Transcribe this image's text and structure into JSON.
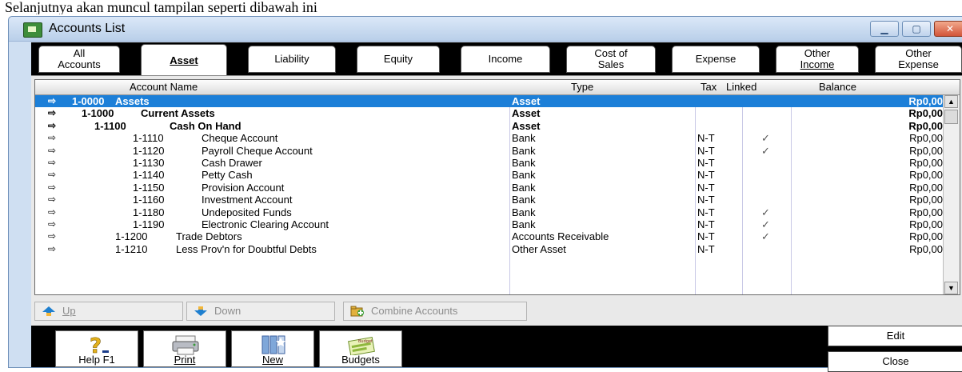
{
  "doc_text": "Selanjutnya akan muncul tampilan seperti dibawah ini",
  "window": {
    "title": "Accounts List"
  },
  "title_buttons": {
    "min": "▁",
    "max": "▢",
    "close": "✕"
  },
  "tabs": [
    {
      "line1": "All",
      "line2": "Accounts"
    },
    {
      "line1": "Asset",
      "line2": ""
    },
    {
      "line1": "Liability",
      "line2": ""
    },
    {
      "line1": "Equity",
      "line2": ""
    },
    {
      "line1": "Income",
      "line2": ""
    },
    {
      "line1": "Cost of",
      "line2": "Sales"
    },
    {
      "line1": "Expense",
      "line2": ""
    },
    {
      "line1": "Other",
      "line2": "Income"
    },
    {
      "line1": "Other",
      "line2": "Expense"
    }
  ],
  "columns": {
    "name": "Account Name",
    "type": "Type",
    "tax": "Tax",
    "linked": "Linked",
    "balance": "Balance"
  },
  "rows": [
    {
      "number": "1-0000",
      "name": "Assets",
      "type": "Asset",
      "tax": "",
      "linked": "",
      "balance": "Rp0,00"
    },
    {
      "number": "1-1000",
      "name": "Current Assets",
      "type": "Asset",
      "tax": "",
      "linked": "",
      "balance": "Rp0,00"
    },
    {
      "number": "1-1100",
      "name": "Cash On Hand",
      "type": "Asset",
      "tax": "",
      "linked": "",
      "balance": "Rp0,00"
    },
    {
      "number": "1-1110",
      "name": "Cheque Account",
      "type": "Bank",
      "tax": "N-T",
      "linked": "✓",
      "balance": "Rp0,00"
    },
    {
      "number": "1-1120",
      "name": "Payroll Cheque Account",
      "type": "Bank",
      "tax": "N-T",
      "linked": "✓",
      "balance": "Rp0,00"
    },
    {
      "number": "1-1130",
      "name": "Cash Drawer",
      "type": "Bank",
      "tax": "N-T",
      "linked": "",
      "balance": "Rp0,00"
    },
    {
      "number": "1-1140",
      "name": "Petty Cash",
      "type": "Bank",
      "tax": "N-T",
      "linked": "",
      "balance": "Rp0,00"
    },
    {
      "number": "1-1150",
      "name": "Provision Account",
      "type": "Bank",
      "tax": "N-T",
      "linked": "",
      "balance": "Rp0,00"
    },
    {
      "number": "1-1160",
      "name": "Investment Account",
      "type": "Bank",
      "tax": "N-T",
      "linked": "",
      "balance": "Rp0,00"
    },
    {
      "number": "1-1180",
      "name": "Undeposited Funds",
      "type": "Bank",
      "tax": "N-T",
      "linked": "✓",
      "balance": "Rp0,00"
    },
    {
      "number": "1-1190",
      "name": "Electronic Clearing Account",
      "type": "Bank",
      "tax": "N-T",
      "linked": "✓",
      "balance": "Rp0,00"
    },
    {
      "number": "1-1200",
      "name": "Trade Debtors",
      "type": "Accounts Receivable",
      "tax": "N-T",
      "linked": "✓",
      "balance": "Rp0,00"
    },
    {
      "number": "1-1210",
      "name": "Less Prov'n for Doubtful Debts",
      "type": "Other Asset",
      "tax": "N-T",
      "linked": "",
      "balance": "Rp0,00"
    }
  ],
  "row_arrow": "⇨",
  "scroll": {
    "up": "▲",
    "down": "▼"
  },
  "actions": {
    "up": "Up",
    "down": "Down",
    "combine": "Combine Accounts"
  },
  "tools": {
    "help": "Help F1",
    "print": "Print",
    "new": "New",
    "budgets": "Budgets"
  },
  "budgets_icon_text": "Budget",
  "right_buttons": {
    "edit": "Edit",
    "close": "Close"
  }
}
